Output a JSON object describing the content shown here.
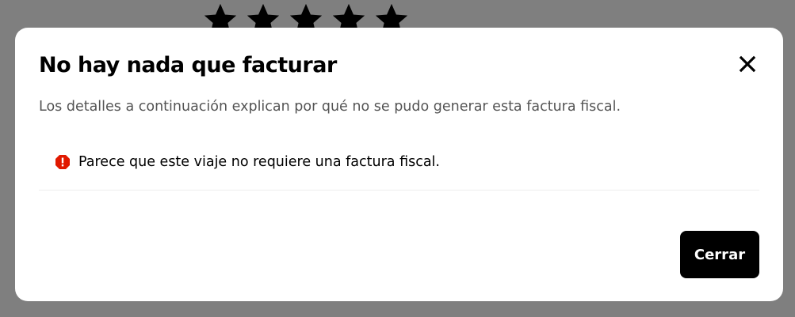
{
  "background": {
    "star_count": 5
  },
  "modal": {
    "title": "No hay nada que facturar",
    "description": "Los detalles a continuación explican por qué no se pudo generar esta factura fiscal.",
    "reasons": [
      {
        "icon": "alert-octagon-icon",
        "text": "Parece que este viaje no requiere una factura fiscal."
      }
    ],
    "close_icon": "close-icon",
    "primary_button_label": "Cerrar"
  },
  "colors": {
    "overlay": "#7f7f7f",
    "surface": "#ffffff",
    "text_primary": "#000000",
    "text_secondary": "#545454",
    "alert": "#e11900",
    "button_bg": "#000000",
    "button_text": "#ffffff"
  }
}
